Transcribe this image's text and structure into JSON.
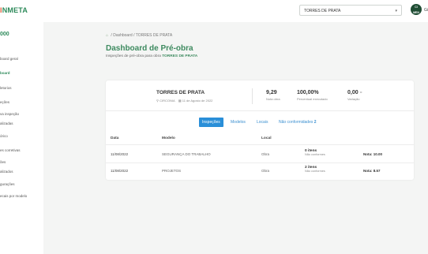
{
  "header": {
    "logo_main": "NMETA",
    "logo_prefix": "I",
    "project_selected": "TORRES DE PRATA",
    "avatar_initials_1": "CI",
    "avatar_initials_2": "MEN",
    "user_name": "Gi"
  },
  "sidebar": {
    "code": "000",
    "items": [
      {
        "label": "board geral"
      },
      {
        "label": "board"
      },
      {
        "label": "letorios"
      },
      {
        "label": "eções"
      },
      {
        "label": "va inspeção"
      },
      {
        "label": "alizadas"
      },
      {
        "label": "órico"
      },
      {
        "label": "es corretivas"
      },
      {
        "label": "ões"
      },
      {
        "label": "alizados"
      },
      {
        "label": "gurações"
      },
      {
        "label": "ecais por modelo"
      }
    ]
  },
  "breadcrumb": {
    "dashboard": "Dashboard",
    "separator": "/",
    "current": "TORRES DE PRATA"
  },
  "page": {
    "title": "Dashboard de Pré-obra",
    "subtitle_prefix": "Inspeções de pré-obra para obra ",
    "subtitle_obra": "TORRES DE PRATA"
  },
  "card": {
    "obra_name": "TORRES DE PRATA",
    "obra_city": "CIRCONIA",
    "obra_date": "11 de Agosto de 2022",
    "stats": [
      {
        "value": "9,29",
        "label": "Nota obra"
      },
      {
        "value": "100,00%",
        "label": "Percentual executado"
      },
      {
        "value": "0,00",
        "suffix": "=",
        "label": "Variação"
      }
    ],
    "tabs": [
      {
        "label": "Inspeções",
        "active": true
      },
      {
        "label": "Modelos"
      },
      {
        "label": "Locais"
      },
      {
        "label": "Não conformidades",
        "badge": "2"
      }
    ],
    "columns": [
      "Data",
      "Modelo",
      "Local"
    ],
    "rows": [
      {
        "date": "11/08/2022",
        "model": "SEGURANÇA DO TRABALHO",
        "local": "Obra",
        "items": "0 itens",
        "items_sub": "Não conformes",
        "grade": "Nota: 10.00"
      },
      {
        "date": "11/08/2022",
        "model": "PROJETOS",
        "local": "Obra",
        "items": "2 itens",
        "items_sub": "Não conformes",
        "grade": "Nota: 8.57"
      }
    ]
  },
  "colors": {
    "brand_green": "#3d8a5f",
    "tab_blue": "#2a8fd8",
    "logo_accent": "#e25c3c"
  }
}
